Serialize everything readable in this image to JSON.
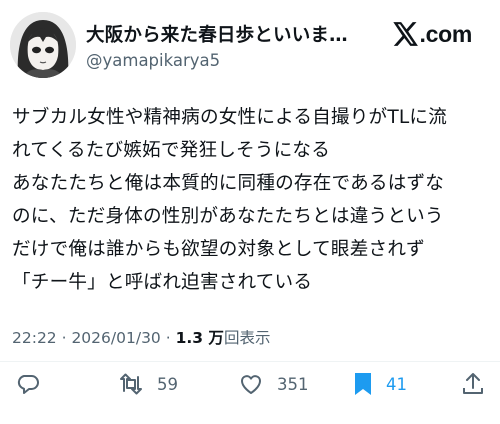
{
  "author": {
    "display_name": "大阪から来た春日歩といいま…",
    "handle": "@yamapikarya5"
  },
  "brand": {
    "domain": ".com"
  },
  "post": {
    "text": "サブカル女性や精神病の女性による自撮りがTLに流\nれてくるたび嫉妬で発狂しそうになる\nあなたたちと俺は本質的に同種の存在であるはずな\nのに、ただ身体の性別があなたたちとは違うという\nだけで俺は誰からも欲望の対象として眼差されず\n「チー牛」と呼ばれ迫害されている"
  },
  "meta": {
    "timestamp": "22:22 · 2026/01/30 · ",
    "views_count": "1.3 万",
    "views_label": "回表示"
  },
  "actions": {
    "reply": {
      "icon": "reply-icon"
    },
    "repost": {
      "icon": "repost-icon",
      "count": "59"
    },
    "like": {
      "icon": "like-icon",
      "count": "351"
    },
    "bookmark": {
      "icon": "bookmark-filled-icon",
      "count": "41"
    },
    "share": {
      "icon": "share-icon"
    }
  },
  "colors": {
    "text": "#0f1419",
    "secondary": "#536471",
    "accent": "#1d9bf0"
  }
}
